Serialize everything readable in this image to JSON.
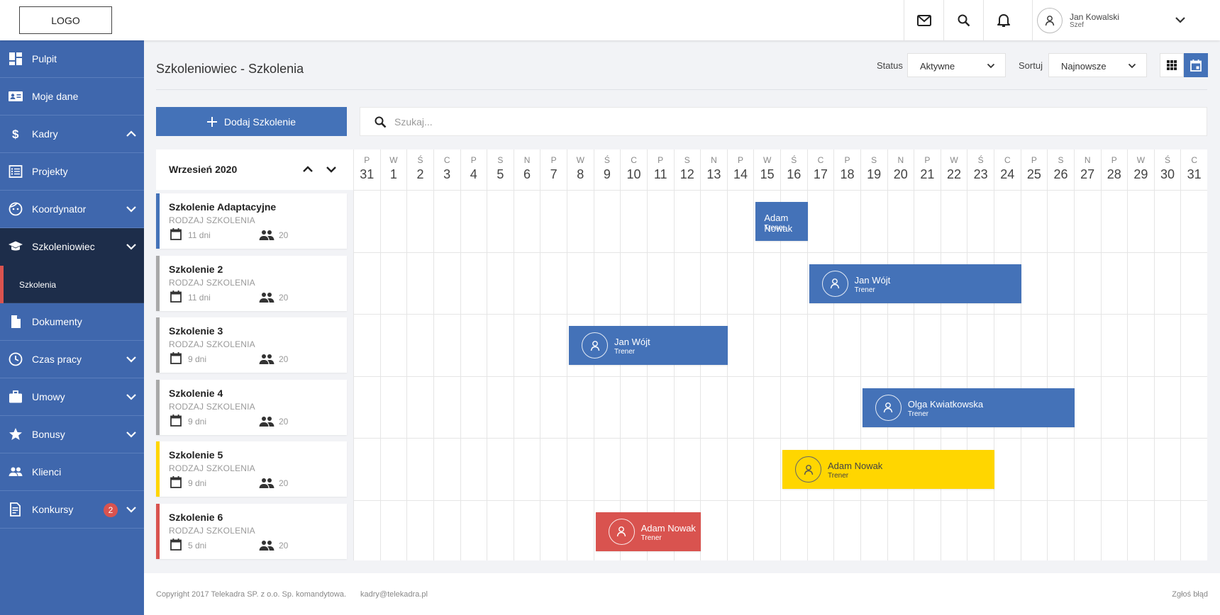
{
  "header": {
    "logo": "LOGO",
    "user_name": "Jan Kowalski",
    "user_role": "Szef"
  },
  "sidebar": {
    "items": [
      {
        "label": "Pulpit"
      },
      {
        "label": "Moje dane"
      },
      {
        "label": "Kadry"
      },
      {
        "label": "Projekty"
      },
      {
        "label": "Koordynator"
      },
      {
        "label": "Szkoleniowiec"
      },
      {
        "label": "Szkolenia"
      },
      {
        "label": "Dokumenty"
      },
      {
        "label": "Czas pracy"
      },
      {
        "label": "Umowy"
      },
      {
        "label": "Bonusy"
      },
      {
        "label": "Klienci"
      },
      {
        "label": "Konkursy",
        "badge": "2"
      }
    ]
  },
  "page": {
    "title": "Szkoleniowiec - Szkolenia",
    "status_label": "Status",
    "status_value": "Aktywne",
    "sort_label": "Sortuj",
    "sort_value": "Najnowsze",
    "add_button": "Dodaj Szkolenie",
    "search_placeholder": "Szukaj..."
  },
  "calendar": {
    "month": "Wrzesień 2020",
    "weekdays": [
      "P",
      "W",
      "Ś",
      "C",
      "P",
      "S",
      "N",
      "P",
      "W",
      "Ś",
      "C",
      "P",
      "S",
      "N",
      "P",
      "W",
      "Ś",
      "C",
      "P",
      "S",
      "N",
      "P",
      "W",
      "Ś",
      "C",
      "P",
      "S",
      "N",
      "P",
      "W",
      "Ś",
      "C"
    ],
    "days": [
      "31",
      "1",
      "2",
      "3",
      "4",
      "5",
      "6",
      "7",
      "8",
      "9",
      "10",
      "11",
      "12",
      "13",
      "14",
      "15",
      "16",
      "17",
      "18",
      "19",
      "20",
      "21",
      "22",
      "23",
      "24",
      "25",
      "26",
      "27",
      "28",
      "29",
      "30",
      "31"
    ],
    "trainings": [
      {
        "title": "Szkolenie Adaptacyjne",
        "type": "RODZAJ SZKOLENIA",
        "duration": "11 dni",
        "participants": "20",
        "accent": "#4472b8"
      },
      {
        "title": "Szkolenie 2",
        "type": "RODZAJ SZKOLENIA",
        "duration": "11 dni",
        "participants": "20",
        "accent": "#a8a8a8"
      },
      {
        "title": "Szkolenie 3",
        "type": "RODZAJ SZKOLENIA",
        "duration": "9 dni",
        "participants": "20",
        "accent": "#a8a8a8"
      },
      {
        "title": "Szkolenie 4",
        "type": "RODZAJ SZKOLENIA",
        "duration": "9 dni",
        "participants": "20",
        "accent": "#a8a8a8"
      },
      {
        "title": "Szkolenie 5",
        "type": "RODZAJ SZKOLENIA",
        "duration": "9 dni",
        "participants": "20",
        "accent": "#ffd600"
      },
      {
        "title": "Szkolenie 6",
        "type": "RODZAJ SZKOLENIA",
        "duration": "5 dni",
        "participants": "20",
        "accent": "#d9534f"
      }
    ],
    "events": [
      {
        "name": "Adam Nowak",
        "role": "Trener",
        "start_day": "15",
        "end_day": "17",
        "color": "#4472b8",
        "avatar": false
      },
      {
        "name": "Jan Wójt",
        "role": "Trener",
        "start_day": "17",
        "end_day": "25",
        "color": "#4472b8",
        "avatar": true
      },
      {
        "name": "Jan Wójt",
        "role": "Trener",
        "start_day": "8",
        "end_day": "14",
        "color": "#4472b8",
        "avatar": true
      },
      {
        "name": "Olga Kwiatkowska",
        "role": "Trener",
        "start_day": "19",
        "end_day": "27",
        "color": "#4472b8",
        "avatar": true
      },
      {
        "name": "Adam Nowak",
        "role": "Trener",
        "start_day": "16",
        "end_day": "24",
        "color": "#ffd600",
        "avatar": true
      },
      {
        "name": "Adam Nowak",
        "role": "Trener",
        "start_day": "9",
        "end_day": "13",
        "color": "#d9534f",
        "avatar": true
      }
    ]
  },
  "footer": {
    "copyright": "Copyright 2017 Telekadra SP. z o.o. Sp. komandytowa.",
    "email": "kadry@telekadra.pl",
    "report": "Zgłoś błąd"
  },
  "colors": {
    "sidebar": "#3f67ad",
    "sidebar_active": "#1d2d4a",
    "primary": "#4472b8",
    "warning": "#ffd600",
    "danger": "#d9534f"
  }
}
